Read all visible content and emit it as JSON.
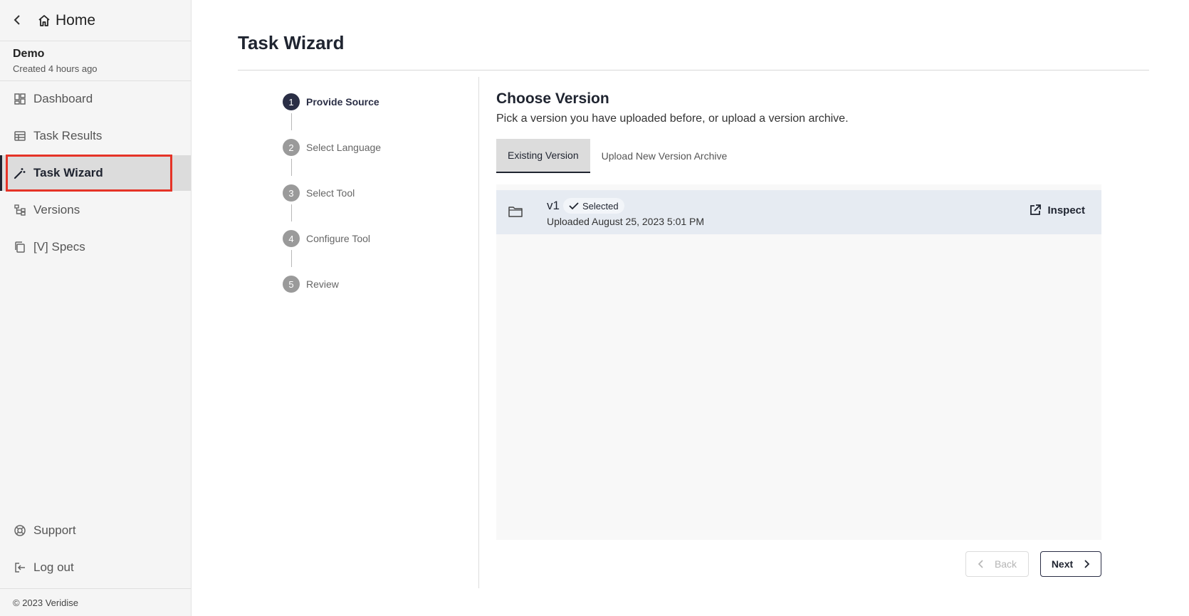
{
  "sidebar": {
    "home_label": "Home",
    "project_name": "Demo",
    "project_created": "Created 4 hours ago",
    "nav": [
      {
        "label": "Dashboard",
        "icon": "dashboard-icon"
      },
      {
        "label": "Task Results",
        "icon": "table-icon"
      },
      {
        "label": "Task Wizard",
        "icon": "magic-wand-icon",
        "active": true
      },
      {
        "label": "Versions",
        "icon": "hierarchy-icon"
      },
      {
        "label": "[V] Specs",
        "icon": "copy-icon"
      }
    ],
    "bottom": [
      {
        "label": "Support",
        "icon": "lifebuoy-icon"
      },
      {
        "label": "Log out",
        "icon": "logout-icon"
      }
    ],
    "footer": "© 2023 Veridise"
  },
  "main": {
    "title": "Task Wizard",
    "steps": [
      {
        "num": "1",
        "label": "Provide Source"
      },
      {
        "num": "2",
        "label": "Select Language"
      },
      {
        "num": "3",
        "label": "Select Tool"
      },
      {
        "num": "4",
        "label": "Configure Tool"
      },
      {
        "num": "5",
        "label": "Review"
      }
    ],
    "current_step": 1,
    "section_title": "Choose Version",
    "section_subtitle": "Pick a version you have uploaded before, or upload a version archive.",
    "tabs": [
      {
        "label": "Existing Version",
        "active": true
      },
      {
        "label": "Upload New Version Archive",
        "active": false
      }
    ],
    "versions": [
      {
        "name": "v1",
        "badge": "Selected",
        "uploaded": "Uploaded August 25, 2023 5:01 PM",
        "action": "Inspect"
      }
    ],
    "back_label": "Back",
    "next_label": "Next"
  },
  "colors": {
    "accent": "#2a2e45",
    "highlight": "#e53327",
    "selected_row": "#e6ebf2"
  }
}
